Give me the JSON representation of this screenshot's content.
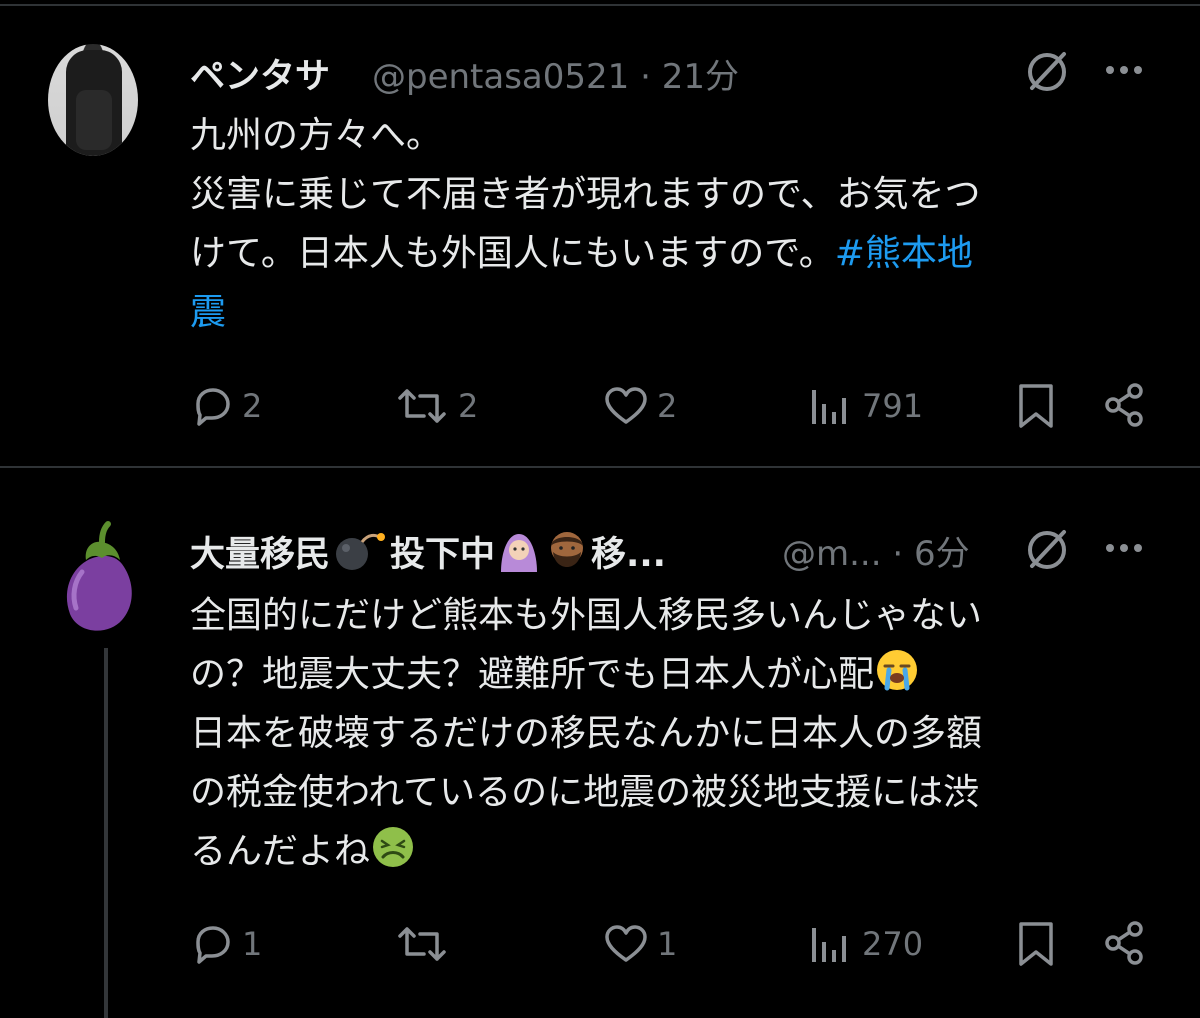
{
  "tweets": [
    {
      "display_name": "ペンタサ",
      "handle_time": "@pentasa0521 · 21分",
      "body_lines": [
        "九州の方々へ。",
        "災害に乗じて不届き者が現れますので、お気をつ",
        "けて。日本人も外国人にもいますので。"
      ],
      "hashtag_part1": "#熊本地",
      "hashtag_part2": "震",
      "replies": "2",
      "retweets": "2",
      "likes": "2",
      "views": "791"
    },
    {
      "display_name_a": "大量移民",
      "display_name_b": "投下中",
      "display_name_c": "移...",
      "handle_time": "@m... · 6分",
      "body_lines": [
        "全国的にだけど熊本も外国人移民多いんじゃない",
        "の？地震大丈夫？避難所でも日本人が心配",
        "日本を破壊するだけの移民なんかに日本人の多額",
        "の税金使われているのに地震の被災地支援には渋",
        "るんだよね"
      ],
      "replies": "1",
      "retweets": "",
      "likes": "1",
      "views": "270"
    }
  ],
  "icons": {
    "reply": "reply-icon",
    "retweet": "retweet-icon",
    "like": "heart-icon",
    "views": "views-icon",
    "bookmark": "bookmark-icon",
    "share": "share-icon",
    "grok": "grok-icon",
    "more": "more-icon"
  },
  "colors": {
    "background": "#000000",
    "hashtag": "#1d9bf0",
    "secondary": "#71767b"
  }
}
